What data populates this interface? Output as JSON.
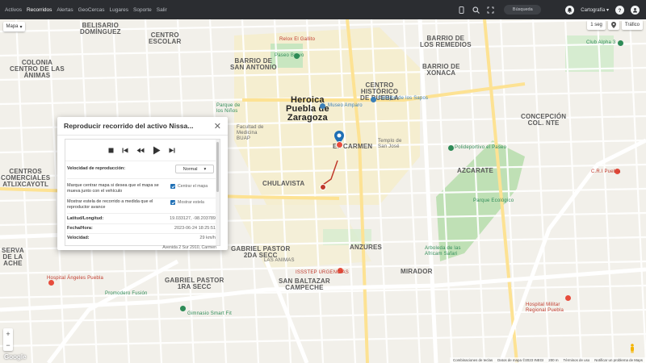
{
  "nav": {
    "items": [
      {
        "label": "Activos",
        "active": false
      },
      {
        "label": "Recorridos",
        "active": true
      },
      {
        "label": "Alertas",
        "active": false
      },
      {
        "label": "GeoCercas",
        "active": false
      },
      {
        "label": "Lugares",
        "active": false
      },
      {
        "label": "Soporte",
        "active": false
      },
      {
        "label": "Salir",
        "active": false
      }
    ],
    "search_label": "Búsqueda",
    "cartography_label": "Cartografía"
  },
  "map_controls": {
    "map_type": "Mapa",
    "interval": "1 seg",
    "traffic": "Tráfico",
    "zoom_in": "+",
    "zoom_out": "−",
    "google": "Google"
  },
  "attribution": {
    "shortcuts": "Combinaciones de teclas",
    "data": "Datos de mapa ©2023 INEGI",
    "scale": "200 m",
    "terms": "Términos de uso",
    "report": "Notificar un problema de Maps"
  },
  "map_labels": [
    {
      "text": "BELISARIO\nDOMÍNGUEZ",
      "cls": ""
    },
    {
      "text": "COLONIA\nCENTRO DE LAS\nÁNIMAS",
      "cls": ""
    },
    {
      "text": "BARRIO DE\nSAN ANTONIO",
      "cls": ""
    },
    {
      "text": "Heroica\nPuebla de\nZaragoza",
      "cls": "big"
    },
    {
      "text": "BARRIO DE\nXONACA",
      "cls": ""
    },
    {
      "text": "CENTRO\nHISTÓRICO\nDE PUEBLA",
      "cls": ""
    },
    {
      "text": "EL CARMEN",
      "cls": ""
    },
    {
      "text": "CENTRO\nESCOLAR",
      "cls": ""
    },
    {
      "text": "BARRIO DE\nLOS REMEDIOS",
      "cls": ""
    },
    {
      "text": "CONCEPCIÓN\nCOL. NTE",
      "cls": ""
    },
    {
      "text": "AZCARATE",
      "cls": ""
    },
    {
      "text": "CHULAVISTA",
      "cls": ""
    },
    {
      "text": "ANZURES",
      "cls": ""
    },
    {
      "text": "GABRIEL PASTOR\n2DA SECC",
      "cls": ""
    },
    {
      "text": "SAN BALTAZAR\nCAMPECHE",
      "cls": ""
    },
    {
      "text": "MIRADOR",
      "cls": ""
    },
    {
      "text": "CENTROS\nCOMERCIALES\nATLIXCAYOTL",
      "cls": ""
    },
    {
      "text": "SERVA\nDE LA\nACHE",
      "cls": ""
    },
    {
      "text": "LAS ANIMAS",
      "cls": ""
    },
    {
      "text": "GABRIEL PASTOR\n1RA SECC",
      "cls": ""
    }
  ],
  "pois": [
    {
      "text": "Paseo Bravo",
      "color": "green"
    },
    {
      "text": "Museo Amparo",
      "color": "blue"
    },
    {
      "text": "Callejón de los Sapos",
      "color": "blue"
    },
    {
      "text": "Club Alpha 3",
      "color": "green"
    },
    {
      "text": "Polideportivo el Paseo",
      "color": "green"
    },
    {
      "text": "Parque Ecológico",
      "color": "green"
    },
    {
      "text": "C.R.I Puebla",
      "color": "red"
    },
    {
      "text": "ISSSTEP URGENCIAS",
      "color": "red"
    },
    {
      "text": "Hospital Ángeles Puebla",
      "color": "red"
    },
    {
      "text": "Gimnasio Smart Fit",
      "color": "green"
    },
    {
      "text": "Hospital Militar\nRegional Puebla",
      "color": "red"
    },
    {
      "text": "Arboleda de las\nAfricam Safari",
      "color": "green"
    },
    {
      "text": "Parque de\nlos Niños",
      "color": "green"
    },
    {
      "text": "Promodero Fusión",
      "color": "green"
    },
    {
      "text": "Relox El Gallito",
      "color": "red"
    },
    {
      "text": "Facultad de\nMedicina\nBUAP",
      "color": "gray"
    },
    {
      "text": "Templo de\nSan José",
      "color": "gray"
    }
  ],
  "dialog": {
    "title": "Reproducir recorrido del activo Nissa...",
    "speed_label": "Velocidad de reproducción:",
    "speed_value": "Normal",
    "center_desc": "Marque centrar mapa si desea que el mapa se mueva junto con el vehículo",
    "center_label": "Centrar el mapa",
    "trail_desc": "Mostrar estela de recorrido a medida que el reproductor avance",
    "trail_label": "Mostrar estela",
    "latlng_label": "Latitud/Longitud:",
    "latlng_value": "19.033127, -98.203789",
    "datetime_label": "Fecha/Hora:",
    "datetime_value": "2023-06-24 18:25:51",
    "speed_field_label": "Velocidad:",
    "speed_field_value": "29 km/h",
    "address": "Avenida 2 Sur 2910, Carmen"
  }
}
